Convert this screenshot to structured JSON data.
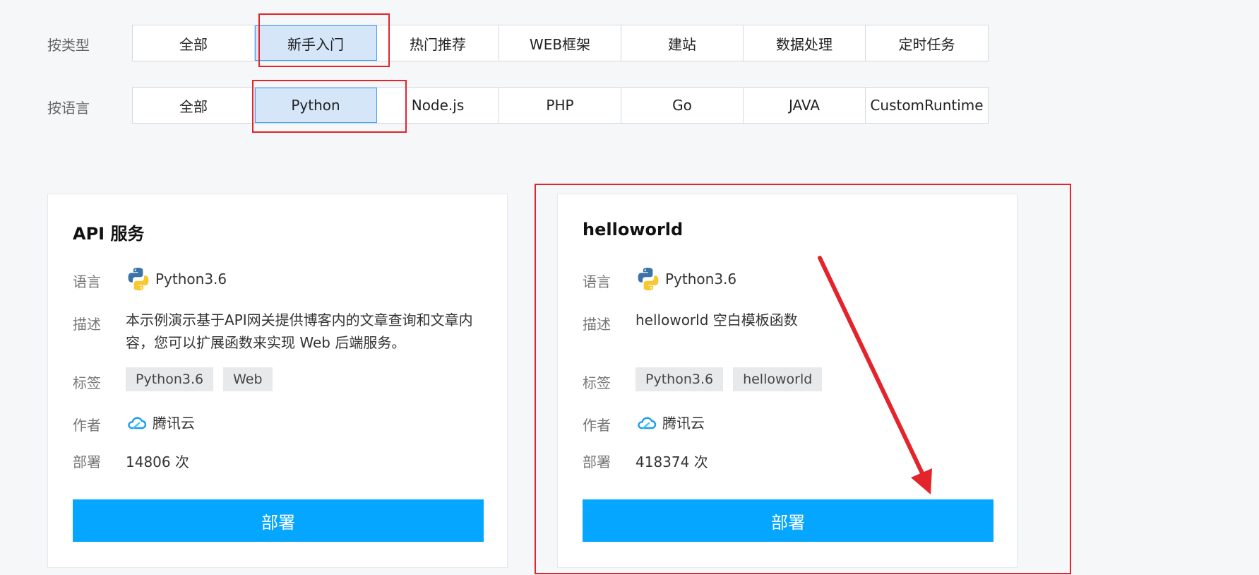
{
  "filters": {
    "type": {
      "label": "按类型",
      "items": [
        "全部",
        "新手入门",
        "热门推荐",
        "WEB框架",
        "建站",
        "数据处理",
        "定时任务"
      ],
      "active_index": 1
    },
    "language": {
      "label": "按语言",
      "items": [
        "全部",
        "Python",
        "Node.js",
        "PHP",
        "Go",
        "JAVA",
        "CustomRuntime"
      ],
      "active_index": 1
    }
  },
  "labels": {
    "language": "语言",
    "description": "描述",
    "tags": "标签",
    "author": "作者",
    "deploy_count": "部署"
  },
  "cards": [
    {
      "title": "API 服务",
      "language": "Python3.6",
      "description": "本示例演示基于API网关提供博客内的文章查询和文章内容，您可以扩展函数来实现 Web 后端服务。",
      "tags": [
        "Python3.6",
        "Web"
      ],
      "author": "腾讯云",
      "deploys": "14806 次",
      "button": "部署"
    },
    {
      "title": "helloworld",
      "language": "Python3.6",
      "description": "helloworld 空白模板函数",
      "tags": [
        "Python3.6",
        "helloworld"
      ],
      "author": "腾讯云",
      "deploys": "418374 次",
      "button": "部署"
    }
  ],
  "colors": {
    "accent": "#04a6ff",
    "active_segment": "#d5e6f9",
    "annotation": "#e3242b"
  }
}
